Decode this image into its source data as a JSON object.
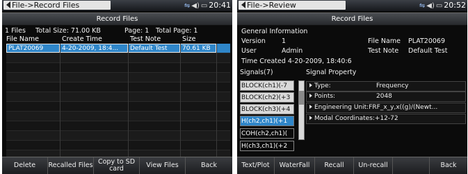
{
  "left": {
    "breadcrumb": "File->Record Files",
    "clock": "20:41",
    "title": "Record Files",
    "summary": {
      "files": "1 Files",
      "total_size": "Total Size: 71.00 KB",
      "page": "Page: 1",
      "total_page": "Total Page: 1"
    },
    "columns": [
      "File Name",
      "Create Time",
      "Test Note",
      "Size"
    ],
    "rows": [
      [
        "PLAT20069",
        "4-20-2009, 18:4...",
        "Default Test",
        "70.61 KB"
      ]
    ],
    "softkeys": [
      "Delete",
      "Recalled Files",
      "Copy to SD card",
      "View Files",
      "Back"
    ]
  },
  "right": {
    "breadcrumb": "File->Review",
    "clock": "20:52",
    "title": "Record Files",
    "general_information": "General Information",
    "version_label": "Version",
    "version_value": "1",
    "file_name_label": "File Name",
    "file_name_value": "PLAT20069",
    "user_label": "User",
    "user_value": "Admin",
    "test_note_label": "Test Note",
    "test_note_value": "Default Test",
    "time_created": "Time Created  4-20-2009, 18:40:6",
    "signals_heading": "Signals(7)",
    "property_heading": "Signal Property",
    "signals": [
      "BLOCK(ch1)(-7",
      "BLOCK(ch2)(+3",
      "BLOCK(ch3)(+4",
      "H(ch2,ch1)(+1",
      "COH(ch2,ch1)(",
      "H(ch3,ch1)(+2"
    ],
    "properties": [
      {
        "label": "Type:",
        "value": "Frequency"
      },
      {
        "label": "Points:",
        "value": "2048"
      },
      {
        "label": "Engineering Unit:FRF_x_y,x((g)/(Newt...",
        "value": ""
      },
      {
        "label": "Modal Coordinates:+12-72",
        "value": ""
      }
    ],
    "softkeys": [
      "Text/Plot",
      "WaterFall",
      "Recall",
      "Un-recall",
      "Back"
    ]
  },
  "icons": [
    "arrow-left-icon",
    "usb-icon",
    "speaker-icon",
    "battery-icon"
  ],
  "colors": {
    "selection": "#2f86c9",
    "background": "#0b0b0b"
  }
}
